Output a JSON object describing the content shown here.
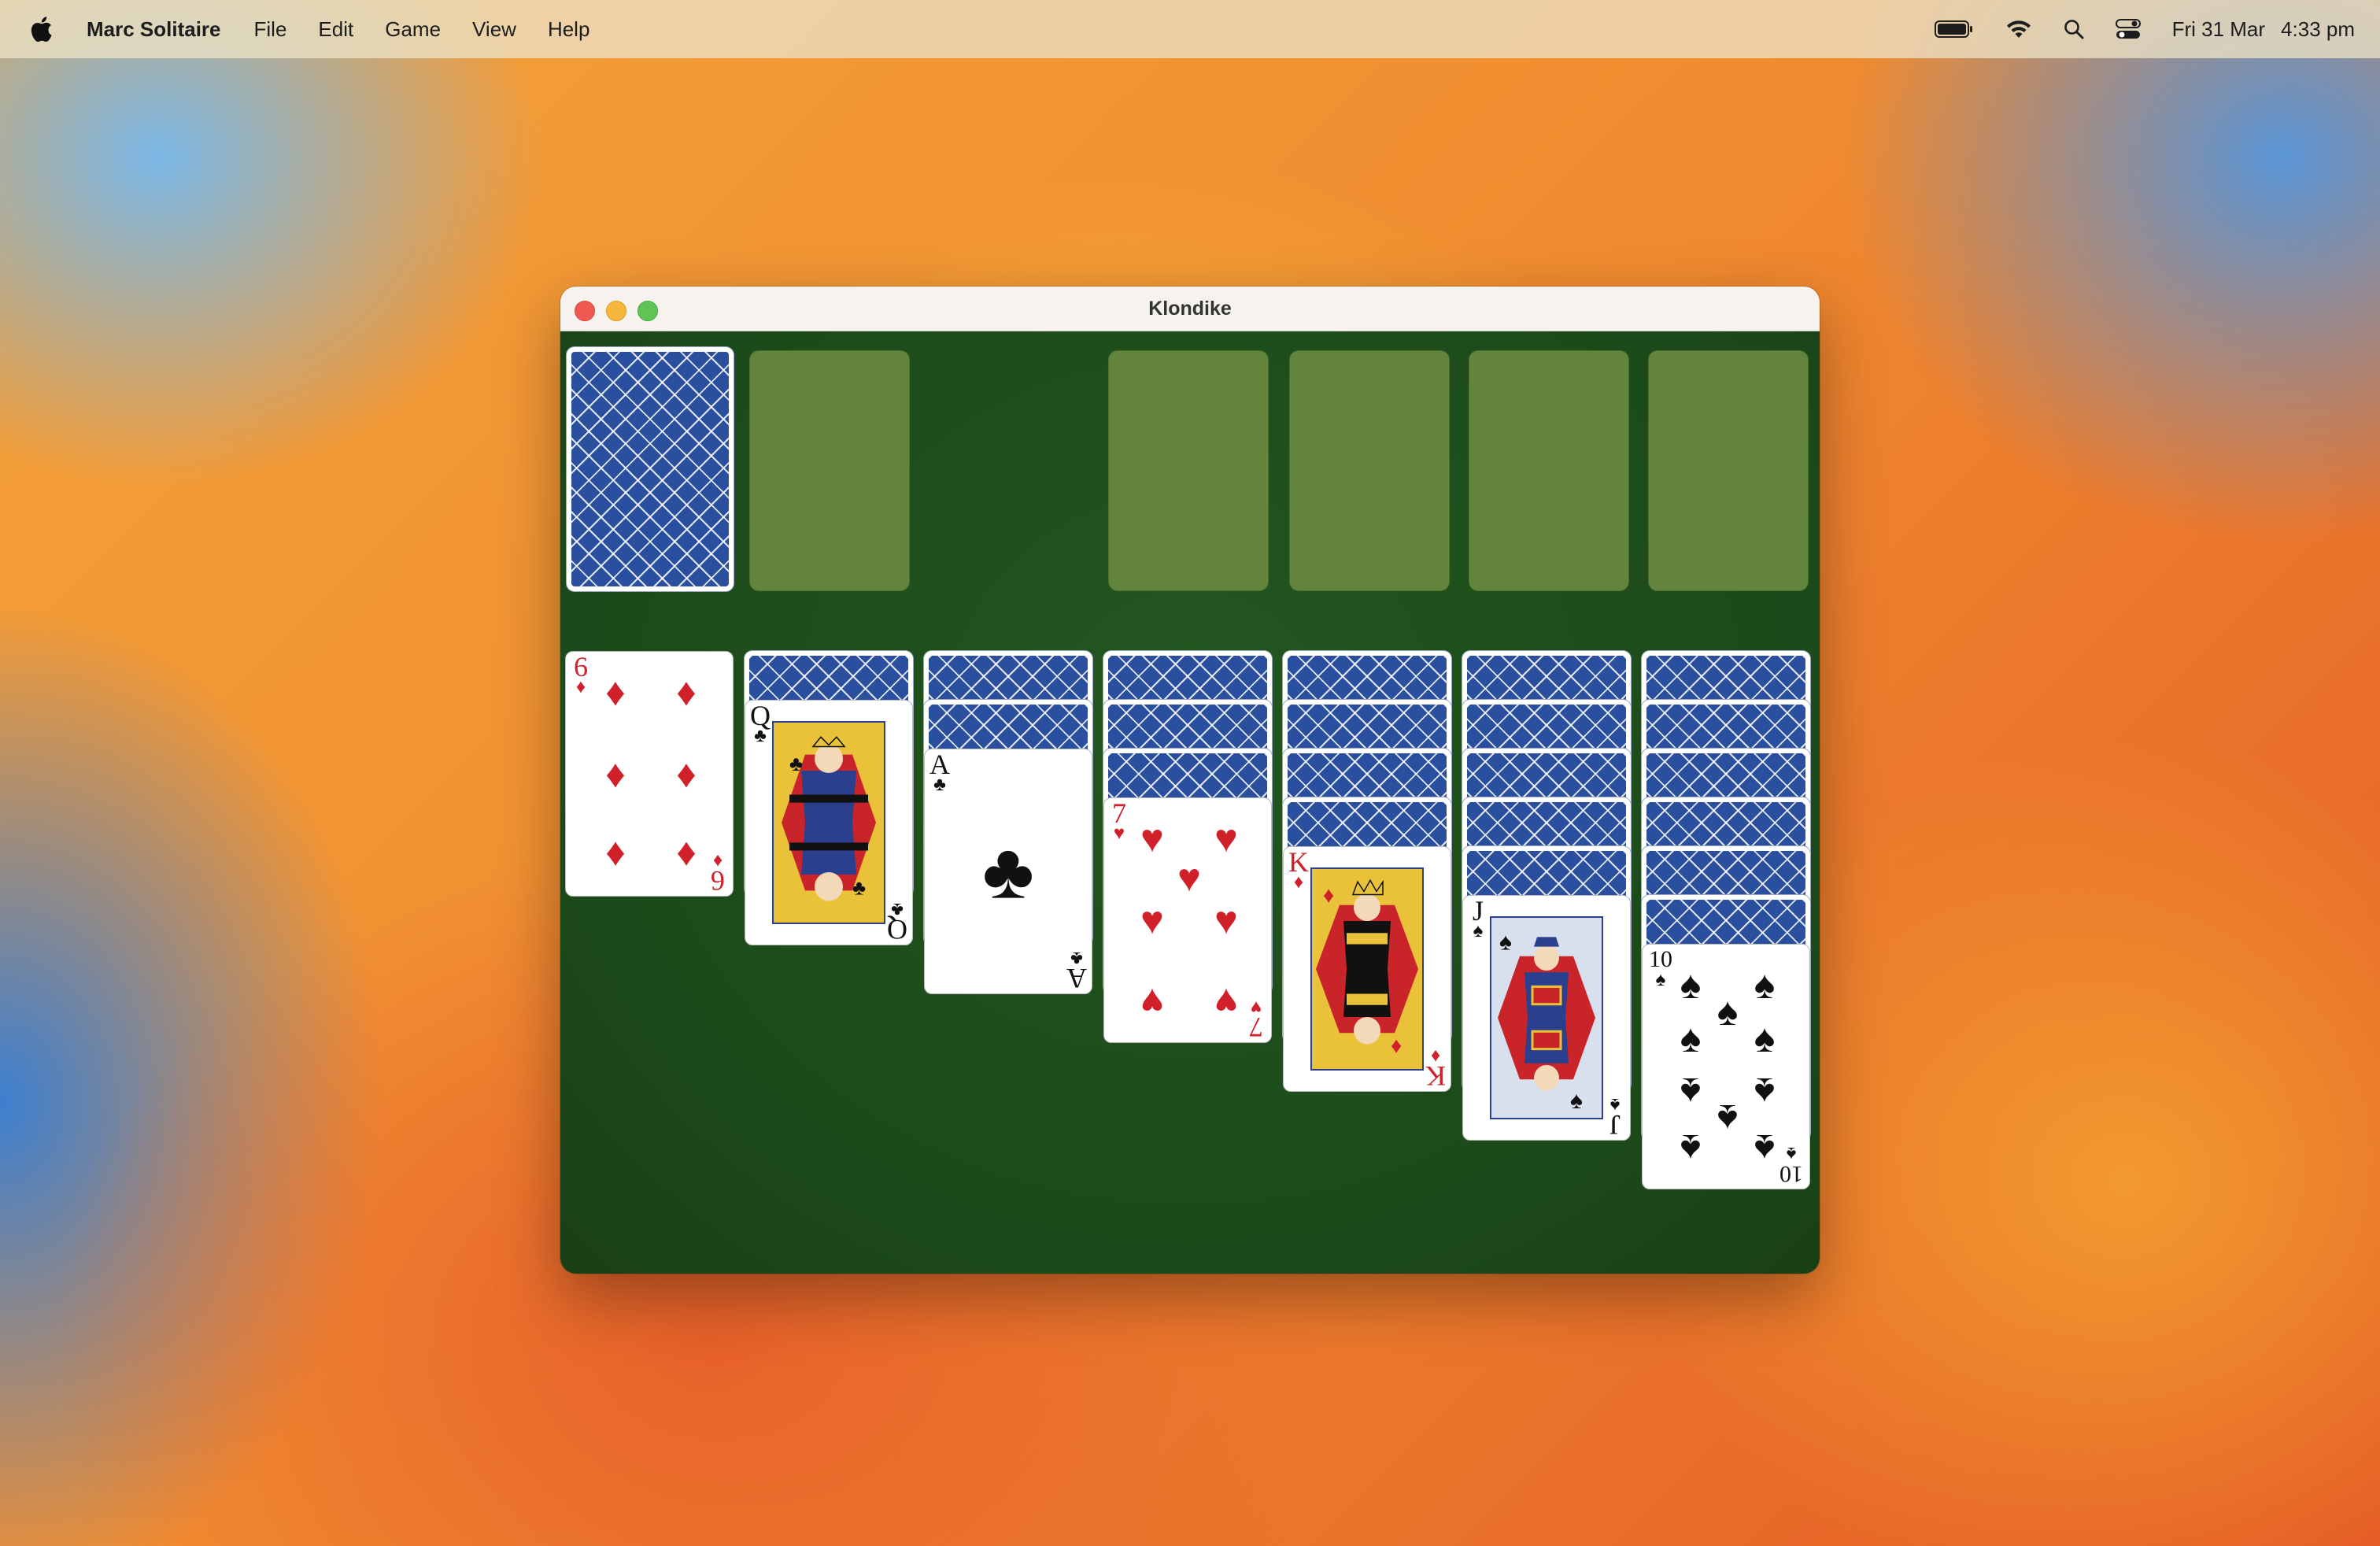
{
  "menubar": {
    "app_name": "Marc Solitaire",
    "items": [
      "File",
      "Edit",
      "Game",
      "View",
      "Help"
    ],
    "status": {
      "battery_icon": "battery-icon",
      "wifi_icon": "wifi-icon",
      "search_icon": "search-icon",
      "control_center_icon": "control-center-icon",
      "date": "Fri 31 Mar",
      "time": "4:33 pm"
    }
  },
  "window": {
    "title": "Klondike",
    "colors": {
      "felt": "#1f521d",
      "slot": "#62843d",
      "card_back": "#2a4f9e",
      "red": "#d0202a"
    }
  },
  "game": {
    "stock": {
      "face_down_count": 1
    },
    "waste": {
      "cards": []
    },
    "foundations": [
      {
        "cards": []
      },
      {
        "cards": []
      },
      {
        "cards": []
      },
      {
        "cards": []
      }
    ],
    "tableau": [
      {
        "face_down": 0,
        "top": {
          "rank": "6",
          "suit": "♦",
          "color": "red"
        }
      },
      {
        "face_down": 1,
        "top": {
          "rank": "Q",
          "suit": "♣",
          "color": "black"
        }
      },
      {
        "face_down": 2,
        "top": {
          "rank": "A",
          "suit": "♣",
          "color": "black"
        }
      },
      {
        "face_down": 3,
        "top": {
          "rank": "7",
          "suit": "♥",
          "color": "red"
        }
      },
      {
        "face_down": 4,
        "top": {
          "rank": "K",
          "suit": "♦",
          "color": "red"
        }
      },
      {
        "face_down": 5,
        "top": {
          "rank": "J",
          "suit": "♠",
          "color": "black"
        }
      },
      {
        "face_down": 6,
        "top": {
          "rank": "10",
          "suit": "♠",
          "color": "black"
        }
      }
    ]
  }
}
